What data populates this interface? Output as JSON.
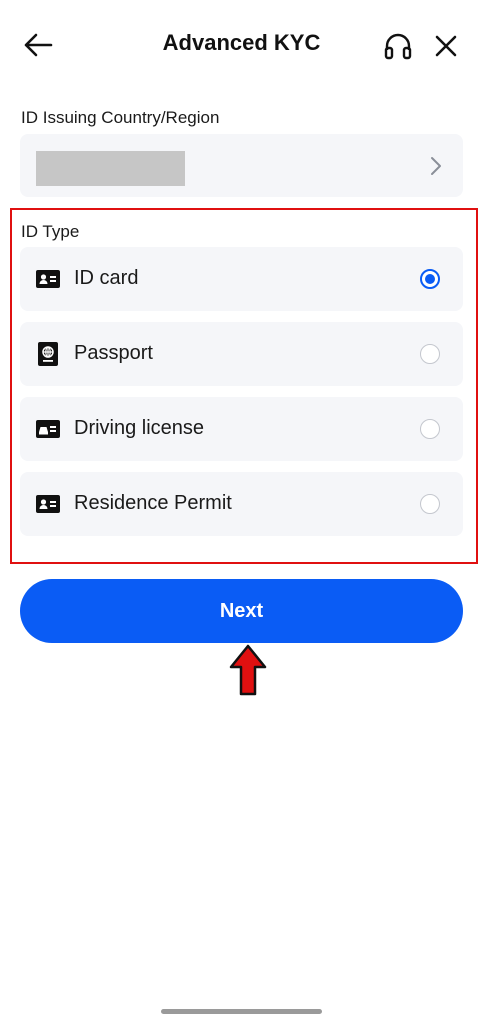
{
  "header": {
    "title": "Advanced KYC",
    "back_icon": "arrow-left-icon",
    "support_icon": "headphones-icon",
    "close_icon": "close-icon"
  },
  "country": {
    "label": "ID Issuing Country/Region",
    "value": "",
    "chevron_icon": "chevron-right-icon"
  },
  "id_type": {
    "label": "ID Type",
    "options": [
      {
        "label": "ID card",
        "icon": "id-card-icon",
        "selected": true
      },
      {
        "label": "Passport",
        "icon": "passport-icon",
        "selected": false
      },
      {
        "label": "Driving license",
        "icon": "driving-license-icon",
        "selected": false
      },
      {
        "label": "Residence Permit",
        "icon": "residence-permit-icon",
        "selected": false
      }
    ]
  },
  "next_button": {
    "label": "Next"
  },
  "annotation": {
    "icon": "red-up-arrow-icon"
  },
  "colors": {
    "accent": "#0a5cf5",
    "highlight_border": "#e01010",
    "field_background": "#f5f6f9"
  }
}
